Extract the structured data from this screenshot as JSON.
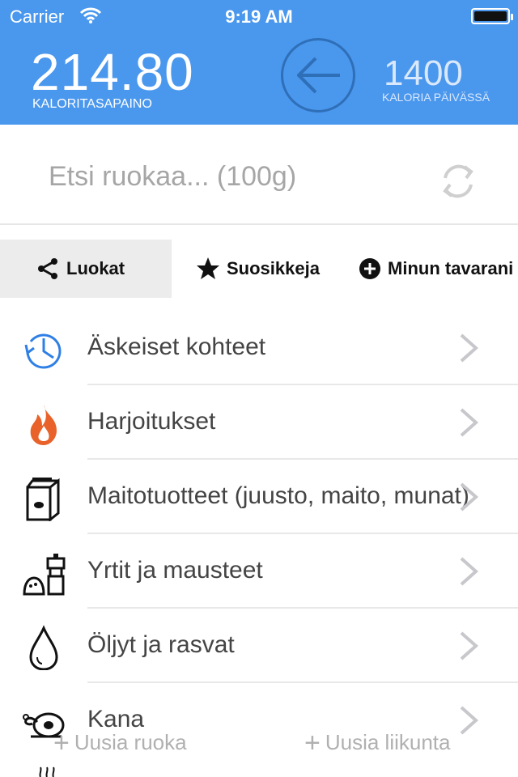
{
  "status_bar": {
    "carrier": "Carrier",
    "time": "9:19 AM"
  },
  "header": {
    "balance_value": "214.80",
    "balance_label": "KALORITASAPAINO",
    "daily_value": "1400",
    "daily_label": "KALORIA PÄIVÄSSÄ",
    "accent_color": "#4a97ee"
  },
  "search": {
    "placeholder": "Etsi ruokaa... (100g)"
  },
  "tabs": [
    {
      "label": "Luokat",
      "icon": "share-icon",
      "active": true
    },
    {
      "label": "Suosikkeja",
      "icon": "star-icon",
      "active": false
    },
    {
      "label": "Minun tavarani",
      "icon": "plus-circle-icon",
      "active": false
    }
  ],
  "list": [
    {
      "label": "Äskeiset kohteet",
      "icon": "history-clock-icon"
    },
    {
      "label": "Harjoitukset",
      "icon": "flame-icon"
    },
    {
      "label": "Maitotuotteet (juusto, maito, munat)",
      "icon": "milk-carton-icon"
    },
    {
      "label": "Yrtit ja mausteet",
      "icon": "spices-icon"
    },
    {
      "label": "Öljyt ja rasvat",
      "icon": "oil-drop-icon"
    },
    {
      "label": "Kana",
      "icon": "chicken-icon"
    }
  ],
  "footer": {
    "new_food": "Uusia ruoka",
    "new_exercise": "Uusia liikunta"
  }
}
